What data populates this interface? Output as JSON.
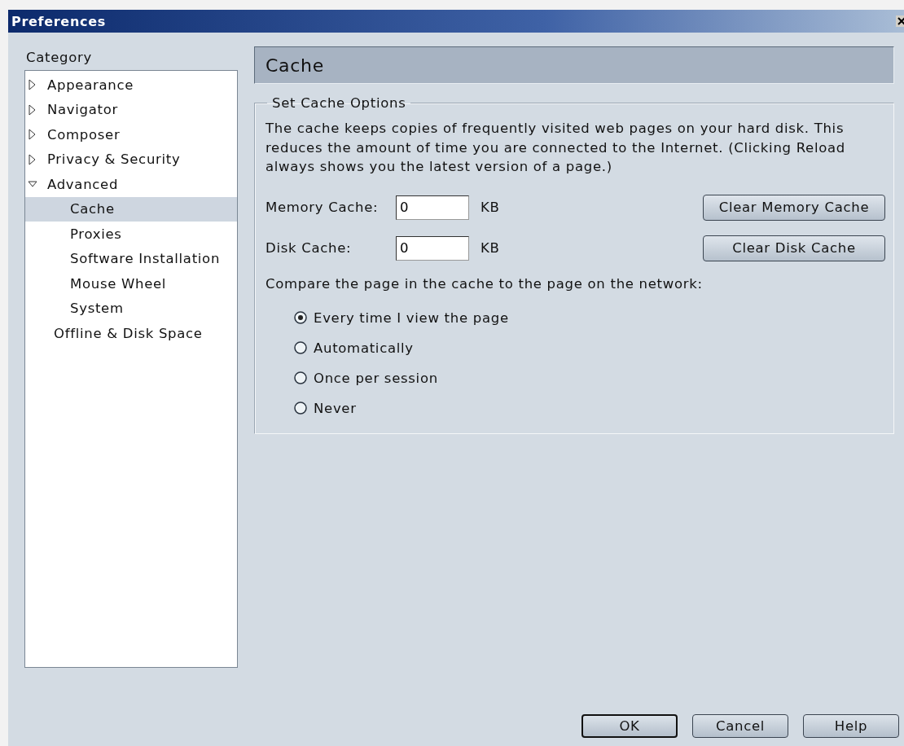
{
  "window": {
    "title": "Preferences"
  },
  "sidebar": {
    "label": "Category",
    "items": [
      {
        "label": "Appearance",
        "expanded": false,
        "selected": false
      },
      {
        "label": "Navigator",
        "expanded": false,
        "selected": false
      },
      {
        "label": "Composer",
        "expanded": false,
        "selected": false
      },
      {
        "label": "Privacy & Security",
        "expanded": false,
        "selected": false
      },
      {
        "label": "Advanced",
        "expanded": true,
        "selected": false,
        "children": [
          {
            "label": "Cache",
            "selected": true
          },
          {
            "label": "Proxies",
            "selected": false
          },
          {
            "label": "Software Installation",
            "selected": false
          },
          {
            "label": "Mouse Wheel",
            "selected": false
          },
          {
            "label": "System",
            "selected": false
          }
        ]
      },
      {
        "label": "Offline & Disk Space",
        "selected": false
      }
    ]
  },
  "panel": {
    "title": "Cache",
    "group": {
      "legend": "Set Cache Options",
      "description": "The cache keeps copies of frequently visited web pages on your hard disk. This reduces the amount of time you are connected to the Internet. (Clicking Reload always shows you the latest version of a page.)",
      "fields": [
        {
          "label": "Memory Cache:",
          "value": "0",
          "unit": "KB",
          "button": {
            "label": "Clear Memory Cache"
          }
        },
        {
          "label": "Disk Cache:",
          "value": "0",
          "unit": "KB",
          "button": {
            "label": "Clear Disk Cache"
          }
        }
      ],
      "compare_label": "Compare the page in the cache to the page on the network:",
      "options": [
        {
          "label": "Every time I view the page",
          "selected": true
        },
        {
          "label": "Automatically",
          "selected": false
        },
        {
          "label": "Once per session",
          "selected": false
        },
        {
          "label": "Never",
          "selected": false
        }
      ]
    }
  },
  "buttons": [
    {
      "label": "OK",
      "default": true
    },
    {
      "label": "Cancel",
      "default": false
    },
    {
      "label": "Help",
      "default": false
    }
  ]
}
